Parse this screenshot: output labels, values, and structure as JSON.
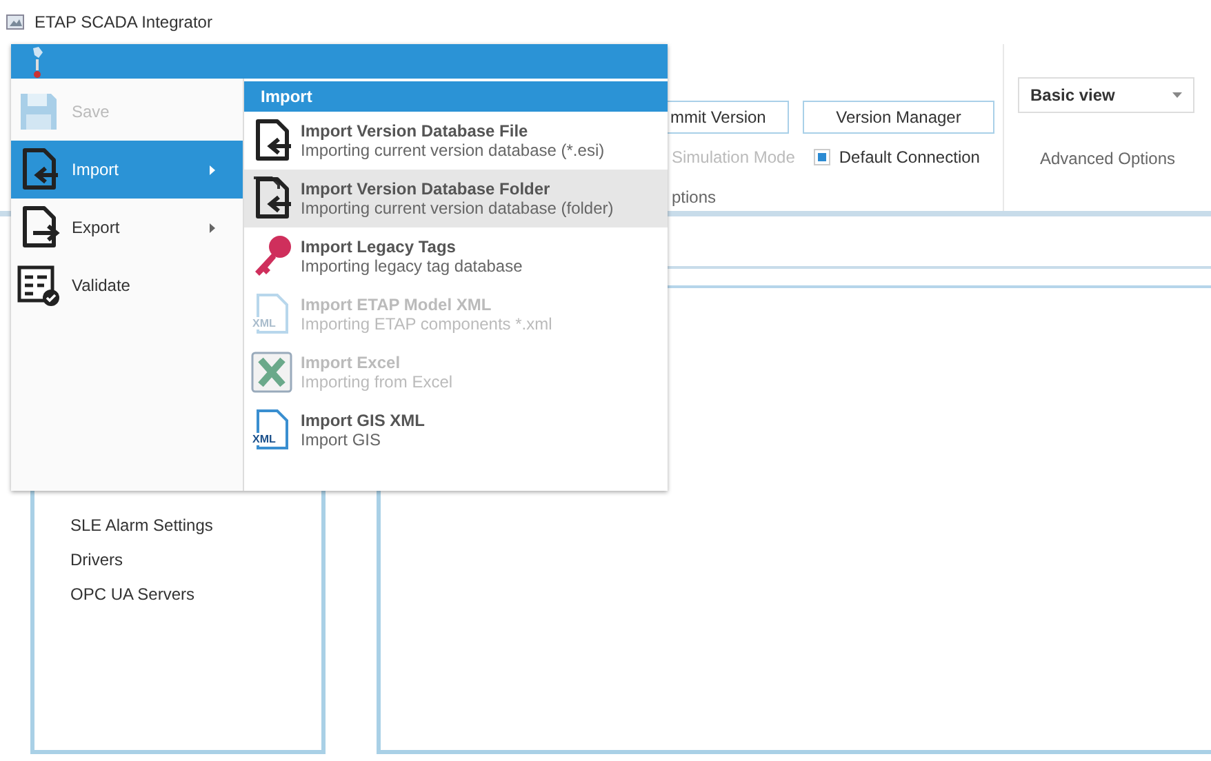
{
  "window": {
    "title": "ETAP SCADA Integrator"
  },
  "ribbon": {
    "buttons": [
      {
        "label": "mmit Version"
      },
      {
        "label": "Version Manager"
      }
    ],
    "simulation_mode": {
      "label": "Simulation Mode",
      "disabled": true
    },
    "default_connection": {
      "label": "Default Connection",
      "checked": true
    },
    "group_label": "ptions",
    "view_select": {
      "value": "Basic view"
    },
    "advanced_label": "Advanced Options"
  },
  "sidebar": {
    "items": [
      "SLE Alarm Settings",
      "Drivers",
      "OPC UA Servers"
    ]
  },
  "app_menu": {
    "items": [
      {
        "label": "Save",
        "kind": "save",
        "disabled": true,
        "selected": false,
        "submenu": false
      },
      {
        "label": "Import",
        "kind": "import",
        "disabled": false,
        "selected": true,
        "submenu": true
      },
      {
        "label": "Export",
        "kind": "export",
        "disabled": false,
        "selected": false,
        "submenu": true
      },
      {
        "label": "Validate",
        "kind": "validate",
        "disabled": false,
        "selected": false,
        "submenu": false
      }
    ],
    "submenu": {
      "title": "Import",
      "items": [
        {
          "title": "Import Version Database File",
          "subtitle": "Importing current version database (*.esi)",
          "kind": "file",
          "disabled": false,
          "selected": false
        },
        {
          "title": "Import Version Database Folder",
          "subtitle": "Importing current version database (folder)",
          "kind": "folder",
          "disabled": false,
          "selected": true
        },
        {
          "title": "Import Legacy Tags",
          "subtitle": "Importing legacy tag database",
          "kind": "key",
          "disabled": false,
          "selected": false
        },
        {
          "title": "Import ETAP Model XML",
          "subtitle": "Importing ETAP components *.xml",
          "kind": "xml",
          "badge": "XML",
          "disabled": true,
          "selected": false
        },
        {
          "title": "Import Excel",
          "subtitle": "Importing from Excel",
          "kind": "excel",
          "disabled": true,
          "selected": false
        },
        {
          "title": "Import GIS XML",
          "subtitle": "Import GIS",
          "kind": "xml",
          "badge": "XML",
          "disabled": false,
          "selected": false
        }
      ]
    }
  }
}
